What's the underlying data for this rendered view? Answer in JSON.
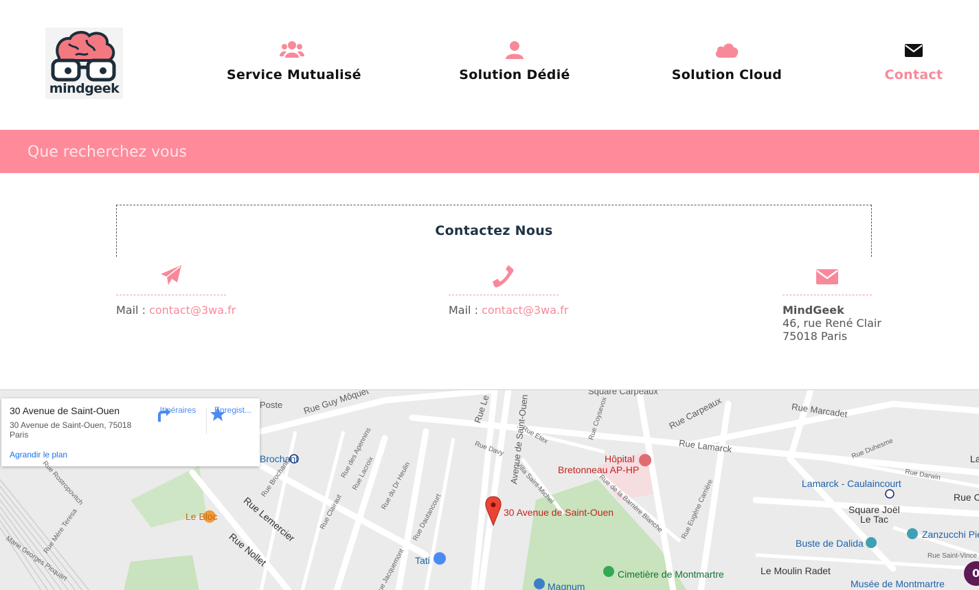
{
  "brand": {
    "logo_text": "mindgeek"
  },
  "nav": {
    "items": [
      {
        "label": "Service Mutualisé",
        "icon": "users-icon"
      },
      {
        "label": "Solution Dédié",
        "icon": "user-icon"
      },
      {
        "label": "Solution Cloud",
        "icon": "cloud-icon"
      },
      {
        "label": "Contact",
        "icon": "envelope-icon",
        "active": true
      }
    ]
  },
  "search": {
    "placeholder": "Que recherchez vous"
  },
  "contact": {
    "title": "Contactez Nous",
    "columns": [
      {
        "icon": "paper-plane-icon",
        "prefix": "Mail : ",
        "link": "contact@3wa.fr"
      },
      {
        "icon": "phone-icon",
        "prefix": "Mail : ",
        "link": "contact@3wa.fr"
      },
      {
        "icon": "envelope-icon",
        "company": "MindGeek",
        "street": "46, rue René Clair",
        "city": "75018 Paris"
      }
    ]
  },
  "map": {
    "card": {
      "title": "30 Avenue de Saint-Ouen",
      "address": "30 Avenue de Saint-Ouen, 75018 Paris",
      "directions_label": "Itinéraires",
      "save_label": "Enregist...",
      "enlarge_label": "Agrandir le plan"
    },
    "marker_label": "30 Avenue de Saint-Ouen",
    "labels": {
      "poste": "Poste",
      "rue_guy_moquet": "Rue Guy Môquet",
      "rue_legendre": "Rue Le",
      "avenue_saint_ouen": "Avenue de Saint-Ouen",
      "square_carpeaux": "Square Carpeaux",
      "rue_carpeaux": "Rue Carpeaux",
      "rue_marcadet": "Rue Marcadet",
      "rue_lamarck": "Rue Lamarck",
      "hopital": "Hôpital",
      "bretonneau": "Bretonneau AP-HP",
      "lamarck_caulaincourt": "Lamarck - Caulaincourt",
      "brochant": "Brochant",
      "le_bloc": "Le Bloc",
      "rue_lemercier": "Rue Lemercier",
      "rue_nollet": "Rue Nollet",
      "tati": "Tati",
      "cimetiere": "Cimetière de Montmartre",
      "magnum": "Magnum",
      "square_joel": "Square Joël",
      "le_tac": "Le Tac",
      "zanzucchi": "Zanzucchi Pie",
      "buste_dalida": "Buste de Dalida",
      "moulin_radet": "Le Moulin Radet",
      "musee_montmartre": "Musée de Montmartre",
      "rue_davy": "Rue Davy",
      "rue_etex": "Rue Etex",
      "rue_coysevox": "Rue Coysevox",
      "villa_saint_michel": "Villa Saint-Michel",
      "rue_barriere_blanche": "Rue de la Barrière Blanche",
      "rue_eugene_carriere": "Rue Eugène Carrière",
      "rue_duhesme": "Rue Duhesme",
      "rue_darwin": "Rue Darwin",
      "rue_ca": "Rue Ca",
      "rue_saint_vincent": "Rue Saint-Vince",
      "rue_brochant": "Rue Brochant",
      "rue_des_apennins": "Rue des Apennins",
      "rue_lacroix": "Rue Lacroix",
      "rue_dr_heulin": "Rue du Dr Heulin",
      "rue_clairaut": "Rue Clairaut",
      "rue_dautancourt": "Rue Dautancourt",
      "rue_jacquemont": "Rue Jacquemont",
      "rue_rostropovitch": "Rue Rostropovitch",
      "rue_mere_teresa": "Rue Mère Teresa",
      "marie_georges_picquart": "Marie Georges Picquart",
      "la": "La"
    },
    "badge": "0"
  },
  "colors": {
    "accent": "#fe8a9a",
    "pink_text": "#f8899a",
    "dark": "#1d3344"
  }
}
